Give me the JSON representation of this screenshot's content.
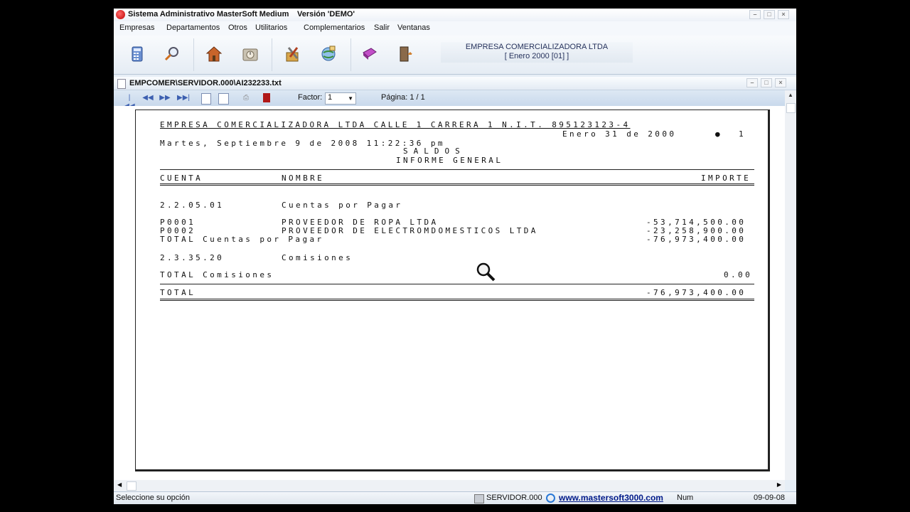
{
  "window": {
    "title": "Sistema Administrativo MasterSoft Medium",
    "version": "Versión 'DEMO'"
  },
  "menu": [
    "Empresas",
    "Departamentos",
    "Otros",
    "Utilitarios",
    "Complementarios",
    "Salir",
    "Ventanas"
  ],
  "toolbar": {
    "icons": [
      "calculator-icon",
      "search-key-icon",
      "home-icon",
      "calendar-icon",
      "tools-icon",
      "globe-icon",
      "book-icon",
      "exit-door-icon"
    ]
  },
  "company": {
    "name": "EMPRESA COMERCIALIZADORA LTDA",
    "period": "[ Enero     2000 [01] ]"
  },
  "document": {
    "path": "EMPCOMER\\SERVIDOR.000\\AI232233.txt",
    "factor_label": "Factor:",
    "factor_value": "1",
    "page_label": "Página: 1 / 1"
  },
  "report": {
    "header_line": "EMPRESA COMERCIALIZADORA LTDA CALLE 1 CARRERA 1 N.I.T. 895123123-4",
    "date": "Enero 31 de 2000",
    "page_no": "1",
    "timestamp": "Martes, Septiembre 9 de 2008 11:22:36 pm",
    "title": "SALDOS",
    "subtitle": "INFORME GENERAL",
    "columns": {
      "cuenta": "CUENTA",
      "nombre": "NOMBRE",
      "importe": "IMPORTE"
    },
    "groups": [
      {
        "account": "2.2.05.01",
        "name": "Cuentas por Pagar",
        "rows": [
          {
            "code": "P0001",
            "name": "PROVEEDOR DE ROPA LTDA",
            "amount": "-53,714,500.00"
          },
          {
            "code": "P0002",
            "name": "PROVEEDOR DE ELECTROMDOMESTICOS LTDA",
            "amount": "-23,258,900.00"
          }
        ],
        "total_label": "TOTAL Cuentas por Pagar",
        "total": "-76,973,400.00"
      },
      {
        "account": "2.3.35.20",
        "name": "Comisiones",
        "rows": [],
        "total_label": "TOTAL Comisiones",
        "total": "0.00"
      }
    ],
    "grand_total_label": "TOTAL",
    "grand_total": "-76,973,400.00"
  },
  "status": {
    "hint": "Seleccione su opción",
    "server": "SERVIDOR.000",
    "website": "www.mastersoft3000.com",
    "numlock": "Num",
    "date": "09-09-08"
  }
}
